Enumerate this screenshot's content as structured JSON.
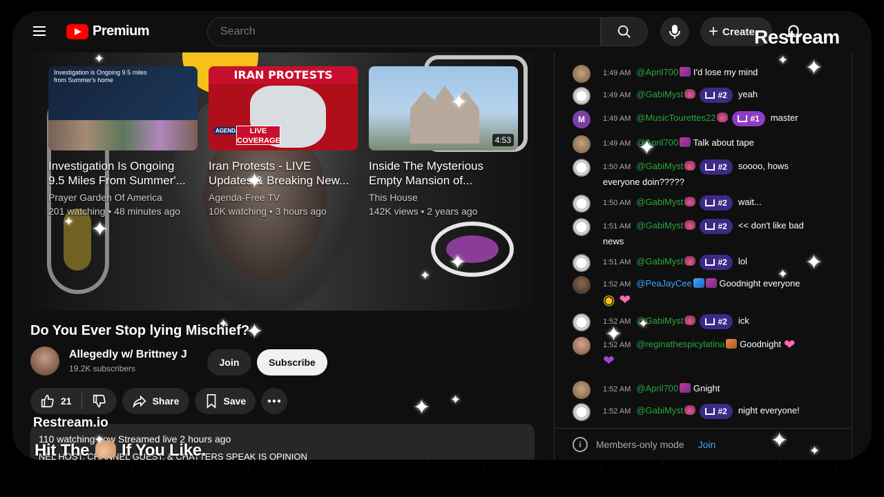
{
  "header": {
    "brand": "Premium",
    "search_placeholder": "Search",
    "create_label": "Create",
    "overlay_logo": "Restream"
  },
  "end_cards": [
    {
      "thumb_text": "Investigation is Ongoing 9.5 miles from Summer's home",
      "title_line1": "Investigation Is Ongoing",
      "title_line2": "9.5 Miles From Summer'...",
      "channel": "Prayer Garden Of America",
      "meta": "201 watching • 48 minutes ago"
    },
    {
      "banner": "IRAN PROTESTS",
      "live_badge": "LIVE COVERAGE",
      "agenda": "AGENDA FREE",
      "title_line1": "Iran Protests - LIVE",
      "title_line2": "Updates & Breaking New...",
      "channel": "Agenda-Free TV",
      "meta": "10K watching • 3 hours ago"
    },
    {
      "duration": "4:53",
      "title_line1": "Inside The Mysterious",
      "title_line2": "Empty Mansion of...",
      "channel": "This House",
      "meta": "142K views • 2 years ago"
    }
  ],
  "video": {
    "title": "Do You Ever Stop lying Mischief?",
    "channel_name": "Allegedly w/ Brittney J",
    "subscribers": "19.2K subscribers",
    "join_label": "Join",
    "subscribe_label": "Subscribe",
    "likes": "21",
    "share_label": "Share",
    "save_label": "Save",
    "desc_line1": "110 watching now  Streamed live 2 hours ago",
    "desc_line2": "NEL HOST, CHANNEL GUEST, & CHATTERS SPEAK IS OPINION"
  },
  "overlay": {
    "restream_io": "Restream.io",
    "hit_before": "Hit The",
    "hit_after": "If You Like."
  },
  "chat": {
    "messages": [
      {
        "time": "1:49 AM",
        "user": "@April700",
        "text": "I'd lose my mind"
      },
      {
        "time": "1:49 AM",
        "user": "@GabiMyst",
        "badge": "#2",
        "text": "yeah"
      },
      {
        "time": "1:49 AM",
        "user": "@MusicTourettes22",
        "badge": "#1",
        "text": "master",
        "avatar_letter": "M"
      },
      {
        "time": "1:49 AM",
        "user": "@April700",
        "text": "Talk about tape"
      },
      {
        "time": "1:50 AM",
        "user": "@GabiMyst",
        "badge": "#2",
        "text": "soooo, hows",
        "text2": "everyone doin?????"
      },
      {
        "time": "1:50 AM",
        "user": "@GabiMyst",
        "badge": "#2",
        "text": "wait..."
      },
      {
        "time": "1:51 AM",
        "user": "@GabiMyst",
        "badge": "#2",
        "text": "<< don't like bad",
        "text2": "news"
      },
      {
        "time": "1:51 AM",
        "user": "@GabiMyst",
        "badge": "#2",
        "text": "lol"
      },
      {
        "time": "1:52 AM",
        "user": "@PeaJayCee",
        "text": "Goodnight everyone"
      },
      {
        "time": "1:52 AM",
        "user": "@GabiMyst",
        "badge": "#2",
        "text": "ick"
      },
      {
        "time": "1:52 AM",
        "user": "@reginathespicylatina",
        "text": "Goodnight"
      },
      {
        "time": "1:52 AM",
        "user": "@April700",
        "text": "Gnight"
      },
      {
        "time": "1:52 AM",
        "user": "@GabiMyst",
        "badge": "#2",
        "text": "night everyone!"
      }
    ],
    "footer_text": "Members-only mode",
    "footer_join": "Join"
  }
}
